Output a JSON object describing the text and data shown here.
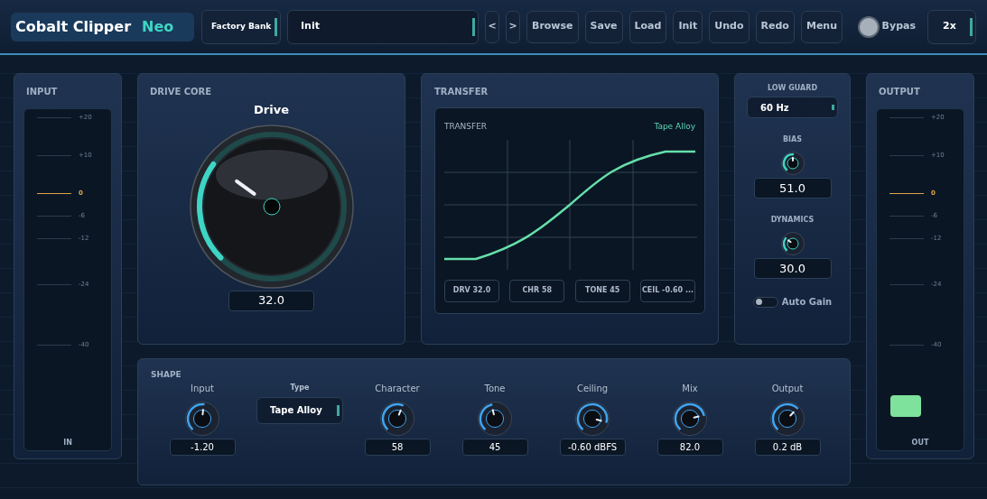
{
  "header": {
    "product": "Cobalt Clipper",
    "edition": "Neo",
    "bank": "Factory Bank",
    "preset": "Init",
    "nav": [
      "<",
      ">"
    ],
    "buttons": [
      "Browse",
      "Save",
      "Load",
      "Init",
      "Undo",
      "Redo",
      "Menu"
    ],
    "bypass": {
      "label": "Bypas",
      "on": false
    },
    "oversampling": "2x"
  },
  "input_meter": {
    "title": "INPUT",
    "label": "IN",
    "ticks": [
      {
        "label": "+20",
        "kind": "tick"
      },
      {
        "label": "+10",
        "kind": "tick"
      },
      {
        "label": "0",
        "kind": "reference"
      },
      {
        "label": "-6",
        "kind": "tick"
      },
      {
        "label": "-12",
        "kind": "tick"
      },
      {
        "label": "-24",
        "kind": "tick"
      },
      {
        "label": "-40",
        "kind": "tick"
      }
    ]
  },
  "drive_core": {
    "title": "DRIVE CORE",
    "label": "Drive",
    "value": "32.0"
  },
  "transfer": {
    "title": "TRANSFER",
    "graph_title": "TRANSFER",
    "curve_name": "Tape Alloy",
    "chips": [
      "DRV 32.0",
      "CHR 58",
      "TONE 45",
      "CEIL -0.60 ..."
    ]
  },
  "side": {
    "low_guard": {
      "label": "LOW GUARD",
      "value": "60 Hz"
    },
    "knobs": [
      {
        "label": "BIAS",
        "value": "51.0"
      },
      {
        "label": "DYNAMICS",
        "value": "30.0"
      }
    ],
    "auto_gain": {
      "label": "Auto Gain",
      "on": false
    }
  },
  "shape": {
    "title": "SHAPE",
    "controls": [
      {
        "kind": "knob",
        "label": "Input",
        "value": "-1.20"
      },
      {
        "kind": "select",
        "label": "Type",
        "value": "Tape Alloy"
      },
      {
        "kind": "knob",
        "label": "Character",
        "value": "58"
      },
      {
        "kind": "knob",
        "label": "Tone",
        "value": "45"
      },
      {
        "kind": "knob",
        "label": "Ceiling",
        "value": "-0.60 dBFS"
      },
      {
        "kind": "knob",
        "label": "Mix",
        "value": "82.0"
      },
      {
        "kind": "knob",
        "label": "Output",
        "value": "0.2 dB"
      }
    ]
  },
  "output_meter": {
    "title": "OUTPUT",
    "label": "OUT",
    "level": 0.1,
    "ticks": [
      {
        "label": "+20",
        "kind": "tick"
      },
      {
        "label": "+10",
        "kind": "tick"
      },
      {
        "label": "0",
        "kind": "reference"
      },
      {
        "label": "-6",
        "kind": "tick"
      },
      {
        "label": "-12",
        "kind": "tick"
      },
      {
        "label": "-24",
        "kind": "tick"
      },
      {
        "label": "-40",
        "kind": "tick"
      }
    ]
  }
}
